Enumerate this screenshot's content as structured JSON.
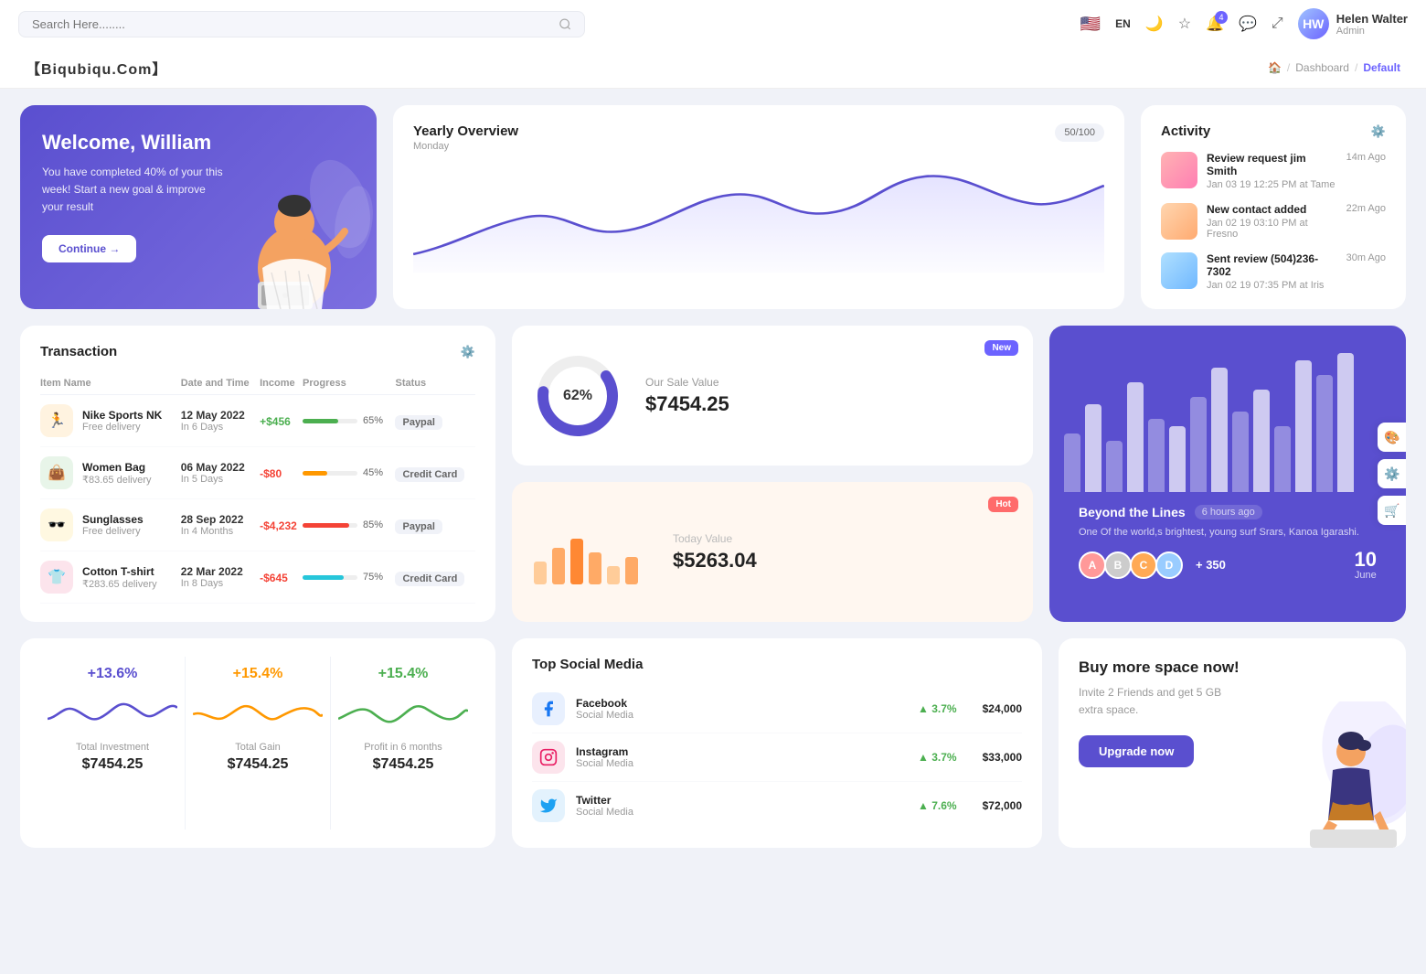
{
  "topNav": {
    "search_placeholder": "Search Here........",
    "lang": "EN",
    "user": {
      "name": "Helen Walter",
      "role": "Admin",
      "initials": "HW"
    }
  },
  "breadcrumb": {
    "brand": "【Biqubiqu.Com】",
    "home": "🏠",
    "path1": "Dashboard",
    "path2": "Default"
  },
  "welcome": {
    "title": "Welcome, William",
    "subtitle": "You have completed 40% of your this week! Start a new goal & improve your result",
    "button": "Continue →"
  },
  "yearlyOverview": {
    "title": "Yearly Overview",
    "subtitle": "Monday",
    "badge": "50/100"
  },
  "activity": {
    "title": "Activity",
    "items": [
      {
        "name": "Review request jim Smith",
        "detail": "Jan 03 19 12:25 PM at Tame",
        "time": "14m Ago"
      },
      {
        "name": "New contact added",
        "detail": "Jan 02 19 03:10 PM at Fresno",
        "time": "22m Ago"
      },
      {
        "name": "Sent review (504)236-7302",
        "detail": "Jan 02 19 07:35 PM at Iris",
        "time": "30m Ago"
      }
    ]
  },
  "transaction": {
    "title": "Transaction",
    "columns": [
      "Item Name",
      "Date and Time",
      "Income",
      "Progress",
      "Status"
    ],
    "rows": [
      {
        "icon": "🏃",
        "name": "Nike Sports NK",
        "sub": "Free delivery",
        "date": "12 May 2022",
        "days": "In 6 Days",
        "income": "+$456",
        "positive": true,
        "progress": 65,
        "color": "green",
        "status": "Paypal"
      },
      {
        "icon": "👜",
        "name": "Women Bag",
        "sub": "₹83.65 delivery",
        "date": "06 May 2022",
        "days": "In 5 Days",
        "income": "-$80",
        "positive": false,
        "progress": 45,
        "color": "orange",
        "status": "Credit Card"
      },
      {
        "icon": "🕶️",
        "name": "Sunglasses",
        "sub": "Free delivery",
        "date": "28 Sep 2022",
        "days": "In 4 Months",
        "income": "-$4,232",
        "positive": false,
        "progress": 85,
        "color": "red",
        "status": "Paypal"
      },
      {
        "icon": "👕",
        "name": "Cotton T-shirt",
        "sub": "₹283.65 delivery",
        "date": "22 Mar 2022",
        "days": "In 8 Days",
        "income": "-$645",
        "positive": false,
        "progress": 75,
        "color": "teal",
        "status": "Credit Card"
      }
    ]
  },
  "saleValue": {
    "badge": "New",
    "percent": "62%",
    "subtitle": "Our Sale Value",
    "value": "$7454.25"
  },
  "todayValue": {
    "badge": "Hot",
    "subtitle": "Today Value",
    "value": "$5263.04"
  },
  "beyondLines": {
    "title": "Beyond the Lines",
    "time": "6 hours ago",
    "desc": "One Of the world,s brightest, young surf Srars, Kanoa Igarashi.",
    "plusCount": "+ 350",
    "date": "10",
    "month": "June"
  },
  "miniStats": [
    {
      "pct": "+13.6%",
      "color": "blue",
      "label": "Total Investment",
      "value": "$7454.25"
    },
    {
      "pct": "+15.4%",
      "color": "orange",
      "label": "Total Gain",
      "value": "$7454.25"
    },
    {
      "pct": "+15.4%",
      "color": "green",
      "label": "Profit in 6 months",
      "value": "$7454.25"
    }
  ],
  "socialMedia": {
    "title": "Top Social Media",
    "items": [
      {
        "icon": "f",
        "name": "Facebook",
        "type": "Social Media",
        "pct": "3.7%",
        "amount": "$24,000"
      },
      {
        "icon": "ig",
        "name": "Instagram",
        "type": "Social Media",
        "pct": "3.7%",
        "amount": "$33,000"
      },
      {
        "icon": "t",
        "name": "Twitter",
        "type": "Social Media",
        "pct": "7.6%",
        "amount": "$72,000"
      }
    ]
  },
  "spaceCard": {
    "title": "Buy more space now!",
    "desc": "Invite 2 Friends and get 5 GB extra space.",
    "button": "Upgrade now"
  },
  "colors": {
    "primary": "#5a4fcf",
    "accent": "#ff6b6b",
    "green": "#4caf50",
    "orange": "#ff9800"
  }
}
